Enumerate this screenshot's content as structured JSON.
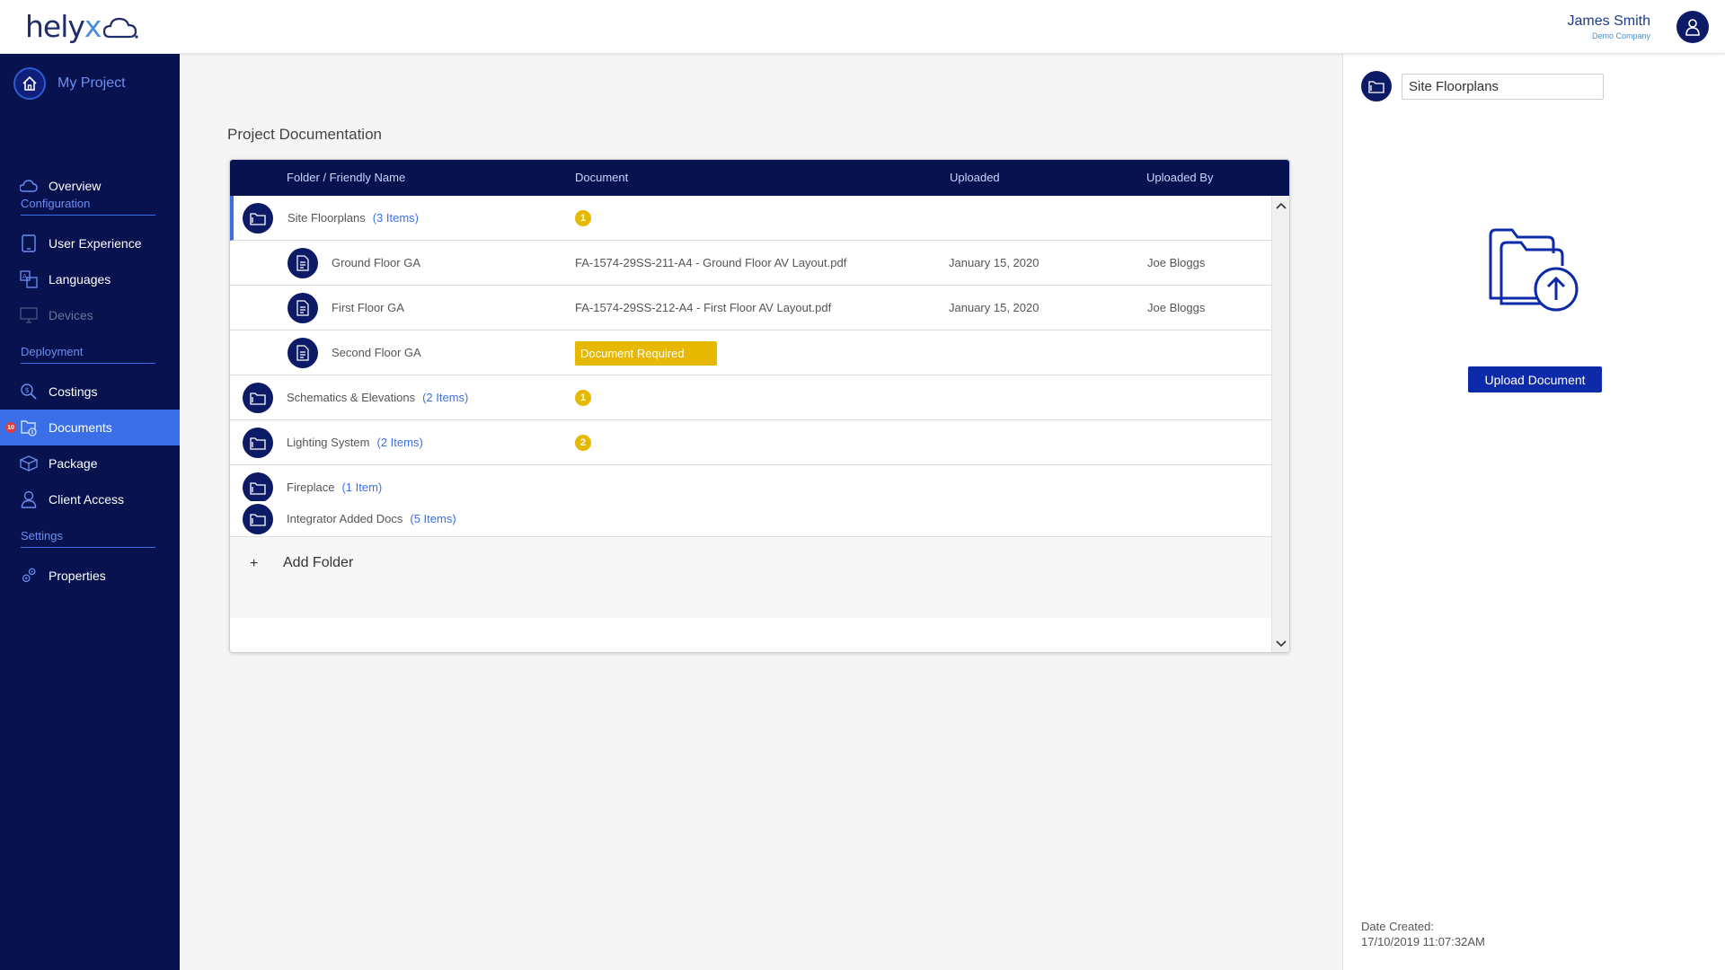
{
  "header": {
    "logo_text": "helyx",
    "user_name": "James Smith",
    "user_company": "Demo Company"
  },
  "sidebar": {
    "project_name": "My Project",
    "items": [
      {
        "label": "Overview",
        "icon": "cloud-icon",
        "type": "item"
      },
      {
        "label": "Configuration",
        "type": "section"
      },
      {
        "label": "User Experience",
        "icon": "tablet-icon",
        "type": "item"
      },
      {
        "label": "Languages",
        "icon": "translate-icon",
        "type": "item"
      },
      {
        "label": "Devices",
        "icon": "monitor-icon",
        "type": "item",
        "disabled": true
      },
      {
        "label": "Deployment",
        "type": "section"
      },
      {
        "label": "Costings",
        "icon": "search-money-icon",
        "type": "item"
      },
      {
        "label": "Documents",
        "icon": "documents-icon",
        "type": "item",
        "active": true,
        "badge": "10"
      },
      {
        "label": "Package",
        "icon": "package-icon",
        "type": "item"
      },
      {
        "label": "Client Access",
        "icon": "user-icon",
        "type": "item"
      },
      {
        "label": "Settings",
        "type": "section"
      },
      {
        "label": "Properties",
        "icon": "gears-icon",
        "type": "item"
      }
    ]
  },
  "main": {
    "title": "Project Documentation",
    "columns": [
      "Folder / Friendly Name",
      "Document",
      "Uploaded",
      "Uploaded By"
    ],
    "rows": [
      {
        "kind": "folder",
        "name": "Site Floorplans",
        "count": "(3 Items)",
        "badge": "1",
        "selected": true
      },
      {
        "kind": "file",
        "name": "Ground Floor GA",
        "document": "FA-1574-29SS-211-A4 - Ground Floor AV Layout.pdf",
        "uploaded": "January 15, 2020",
        "uploaded_by": "Joe Bloggs"
      },
      {
        "kind": "file",
        "name": "First Floor GA",
        "document": "FA-1574-29SS-212-A4 - First Floor AV Layout.pdf",
        "uploaded": "January 15, 2020",
        "uploaded_by": "Joe Bloggs"
      },
      {
        "kind": "file",
        "name": "Second Floor GA",
        "required": "Document Required"
      },
      {
        "kind": "folder",
        "name": "Schematics & Elevations",
        "count": "(2 Items)",
        "badge": "1"
      },
      {
        "kind": "folder",
        "name": "Lighting System",
        "count": "(2 Items)",
        "badge": "2"
      },
      {
        "kind": "folder",
        "name": "Fireplace",
        "count": "(1 Item)"
      },
      {
        "kind": "folder",
        "name": "Integrator Added Docs",
        "count": "(5 Items)"
      }
    ],
    "add_folder_plus": "+",
    "add_folder_label": "Add Folder"
  },
  "panel": {
    "folder_name_value": "Site Floorplans",
    "upload_button": "Upload Document",
    "date_label": "Date Created:",
    "date_value": "17/10/2019 11:07:32AM"
  },
  "colors": {
    "navy": "#08124e",
    "accent_blue": "#3a6fe8",
    "badge_yellow": "#e6b800",
    "button_blue": "#0d2aa8"
  }
}
